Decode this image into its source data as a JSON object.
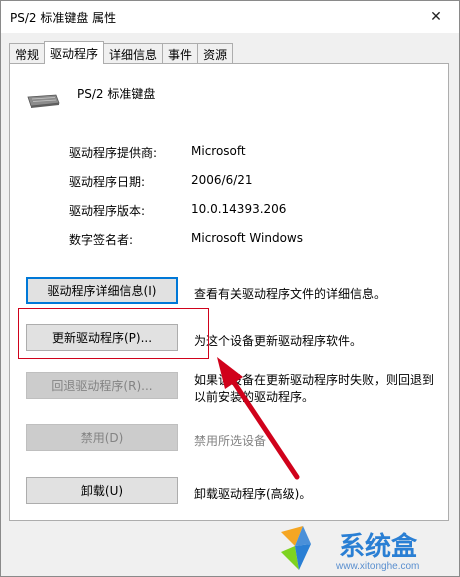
{
  "window": {
    "title": "PS/2 标准键盘 属性",
    "close_glyph": "✕"
  },
  "tabs": [
    {
      "label": "常规"
    },
    {
      "label": "驱动程序",
      "active": true
    },
    {
      "label": "详细信息"
    },
    {
      "label": "事件"
    },
    {
      "label": "资源"
    }
  ],
  "device": {
    "name": "PS/2 标准键盘",
    "icon": "keyboard-icon"
  },
  "properties": [
    {
      "label": "驱动程序提供商:",
      "value": "Microsoft"
    },
    {
      "label": "驱动程序日期:",
      "value": "2006/6/21"
    },
    {
      "label": "驱动程序版本:",
      "value": "10.0.14393.206"
    },
    {
      "label": "数字签名者:",
      "value": "Microsoft Windows"
    }
  ],
  "actions": [
    {
      "button": "驱动程序详细信息(I)",
      "description": "查看有关驱动程序文件的详细信息。",
      "enabled": true
    },
    {
      "button": "更新驱动程序(P)...",
      "description": "为这个设备更新驱动程序软件。",
      "enabled": true
    },
    {
      "button": "回退驱动程序(R)...",
      "description_line1": "如果该设备在更新驱动程序时失败，则回退到",
      "description_line2": "以前安装的驱动程序。",
      "enabled": false
    },
    {
      "button": "禁用(D)",
      "description": "禁用所选设备",
      "enabled": false
    },
    {
      "button": "卸载(U)",
      "description": "卸载驱动程序(高级)。",
      "enabled": true
    }
  ],
  "watermark": {
    "name": "系统盒",
    "url": "www.xitonghe.com"
  },
  "colors": {
    "highlight": "#d0021b",
    "arrow": "#d0021b",
    "focus": "#0078d7"
  }
}
